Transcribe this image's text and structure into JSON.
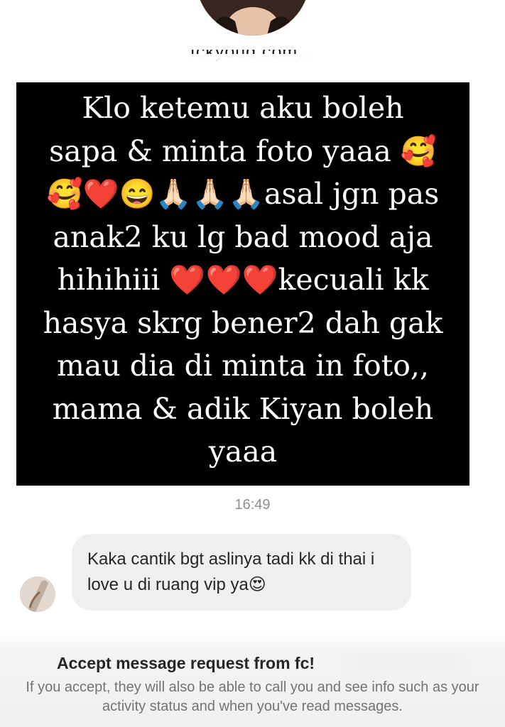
{
  "profile": {
    "username": "fckyoud.com..."
  },
  "story_reply": {
    "text": "Klo ketemu aku boleh\nsapa & minta foto yaaa 🥰\n🥰❤️😄🙏🏻🙏🏻🙏🏻asal jgn pas\nanak2 ku lg bad mood aja\nhihihiii ❤️❤️❤️kecuali kk\nhasya skrg bener2 dah gak\nmau dia di minta in foto,,\nmama & adik Kiyan boleh\nyaaa"
  },
  "thread": {
    "timestamp": "16:49",
    "messages": [
      {
        "text": "Kaka cantik bgt aslinya tadi kk di thai i love u di ruang vip ya😍"
      }
    ]
  },
  "request": {
    "title": "Accept message request from fc!",
    "description": "If you accept, they will also be able to call you and see info such as your activity status and when you've read messages."
  }
}
